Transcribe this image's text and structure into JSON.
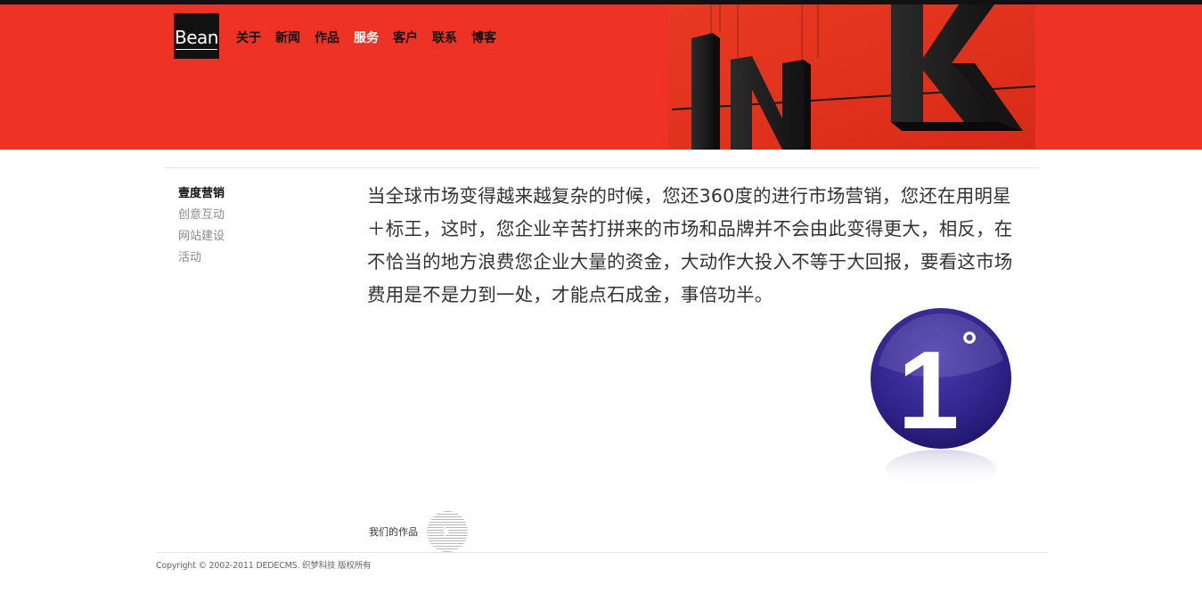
{
  "brand": {
    "logo_text": "Bean"
  },
  "nav": {
    "items": [
      {
        "label": "关于"
      },
      {
        "label": "新闻"
      },
      {
        "label": "作品"
      },
      {
        "label": "服务"
      },
      {
        "label": "客户"
      },
      {
        "label": "联系"
      },
      {
        "label": "博客"
      }
    ],
    "active_index": 3
  },
  "banner": {
    "letters": [
      "I",
      "N",
      "K"
    ]
  },
  "sidebar": {
    "items": [
      {
        "label": "壹度营销"
      },
      {
        "label": "创意互动"
      },
      {
        "label": "网站建设"
      },
      {
        "label": "活动"
      }
    ],
    "active_index": 0
  },
  "main": {
    "paragraph": "当全球市场变得越来越复杂的时候，您还360度的进行市场营销，您还在用明星＋标王，这时，您企业辛苦打拼来的市场和品牌并不会由此变得更大，相反，在不恰当的地方浪费您企业大量的资金，大动作大投入不等于大回报，要看这市场费用是不是力到一处，才能点石成金，事倍功半。"
  },
  "badge": {
    "digit": "1",
    "symbol": "°"
  },
  "works": {
    "label": "我们的作品"
  },
  "footer": {
    "copyright": "Copyright © 2002-2011 DEDECMS. 织梦科技 版权所有"
  },
  "colors": {
    "header_red": "#ee3224",
    "badge_purple": "#35278f",
    "text": "#333333"
  }
}
